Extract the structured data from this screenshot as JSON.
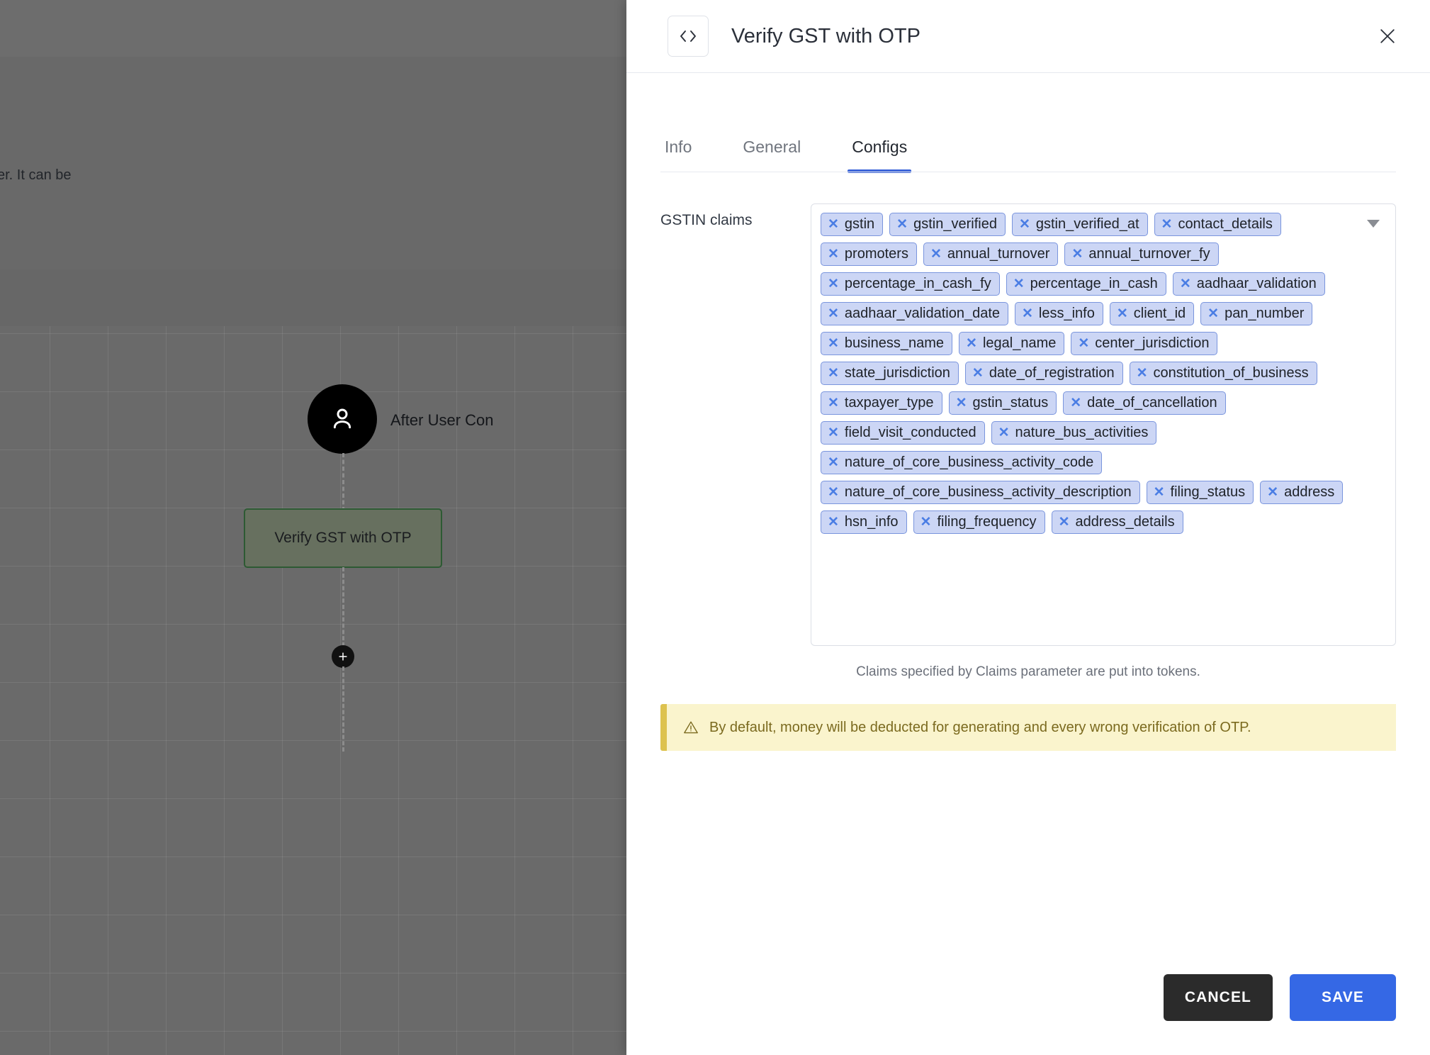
{
  "canvas": {
    "clipped_text": "er. It can be",
    "user_node_label": "After User Con",
    "step_node_label": "Verify GST with OTP",
    "user_icon": "person-icon",
    "add_icon": "plus-icon"
  },
  "panel": {
    "icon": "code-brackets-icon",
    "title": "Verify GST with OTP",
    "close_icon": "close-icon"
  },
  "tabs": [
    {
      "label": "Info",
      "active": false
    },
    {
      "label": "General",
      "active": false
    },
    {
      "label": "Configs",
      "active": true
    }
  ],
  "field": {
    "label": "GSTIN claims",
    "caret_icon": "chevron-down-icon",
    "chips": [
      "gstin",
      "gstin_verified",
      "gstin_verified_at",
      "contact_details",
      "promoters",
      "annual_turnover",
      "annual_turnover_fy",
      "percentage_in_cash_fy",
      "percentage_in_cash",
      "aadhaar_validation",
      "aadhaar_validation_date",
      "less_info",
      "client_id",
      "pan_number",
      "business_name",
      "legal_name",
      "center_jurisdiction",
      "state_jurisdiction",
      "date_of_registration",
      "constitution_of_business",
      "taxpayer_type",
      "gstin_status",
      "date_of_cancellation",
      "field_visit_conducted",
      "nature_bus_activities",
      "nature_of_core_business_activity_code",
      "nature_of_core_business_activity_description",
      "filing_status",
      "address",
      "hsn_info",
      "filing_frequency",
      "address_details"
    ],
    "remove_chip_glyph": "✕",
    "helper_text": "Claims specified by Claims parameter are put into tokens."
  },
  "warning": {
    "icon": "warning-triangle-icon",
    "text": "By default, money will be deducted for generating and every wrong verification of OTP."
  },
  "footer": {
    "cancel_label": "CANCEL",
    "save_label": "SAVE"
  },
  "colors": {
    "accent_blue": "#3b64d8",
    "save_blue": "#3568e5",
    "cancel_dark": "#2b2b2b",
    "chip_bg": "#ccd6f5",
    "chip_border": "#7a95dd",
    "chip_x": "#4a7de4",
    "warning_bg": "#faf4cd",
    "warning_border": "#ddc24f",
    "warning_text": "#7b6a1f",
    "node_green": "#67705f",
    "node_green_border": "#2d5a33"
  }
}
